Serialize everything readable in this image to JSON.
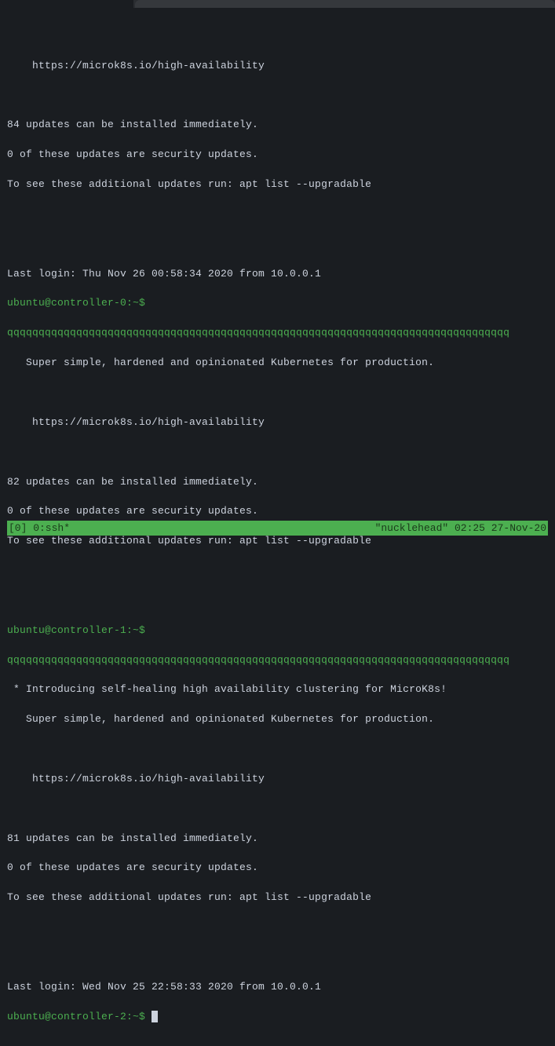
{
  "blocks": {
    "b0": {
      "url": "    https://microk8s.io/high-availability",
      "updates": "84 updates can be installed immediately.",
      "security": "0 of these updates are security updates.",
      "hint": "To see these additional updates run: apt list --upgradable",
      "last_login": "Last login: Thu Nov 26 00:58:34 2020 from 10.0.0.1",
      "prompt": "ubuntu@controller-0:~$ "
    },
    "divider": "qqqqqqqqqqqqqqqqqqqqqqqqqqqqqqqqqqqqqqqqqqqqqqqqqqqqqqqqqqqqqqqqqqqqqqqqqqqqqqqq",
    "b1": {
      "slogan": "   Super simple, hardened and opinionated Kubernetes for production.",
      "url": "    https://microk8s.io/high-availability",
      "updates": "82 updates can be installed immediately.",
      "security": "0 of these updates are security updates.",
      "hint": "To see these additional updates run: apt list --upgradable",
      "prompt": "ubuntu@controller-1:~$ "
    },
    "b2": {
      "intro": " * Introducing self-healing high availability clustering for MicroK8s!",
      "slogan": "   Super simple, hardened and opinionated Kubernetes for production.",
      "url": "    https://microk8s.io/high-availability",
      "updates": "81 updates can be installed immediately.",
      "security": "0 of these updates are security updates.",
      "hint": "To see these additional updates run: apt list --upgradable",
      "last_login": "Last login: Wed Nov 25 22:58:33 2020 from 10.0.0.1",
      "prompt": "ubuntu@controller-2:~$ "
    }
  },
  "status": {
    "left": "[0] 0:ssh*",
    "right": "\"nucklehead\" 02:25 27-Nov-20"
  }
}
